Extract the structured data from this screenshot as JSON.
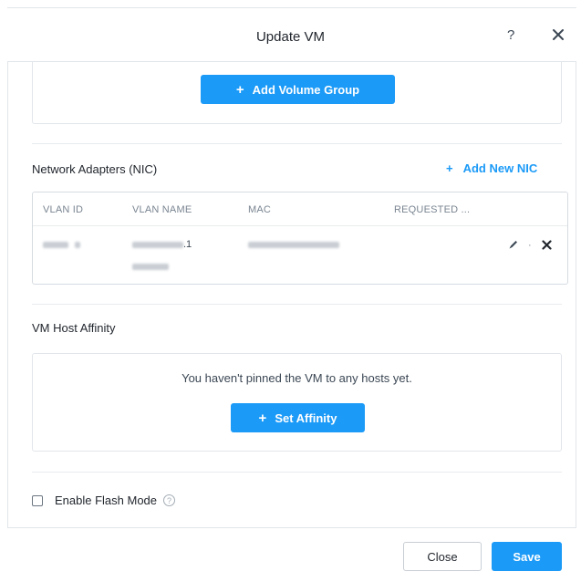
{
  "dialog": {
    "title": "Update VM",
    "help_label": "?",
    "close_icon": "close-icon"
  },
  "volume_groups": {
    "add_button_label": "Add Volume Group",
    "add_button_icon": "+"
  },
  "network_adapters": {
    "section_title": "Network Adapters (NIC)",
    "add_nic_label": "Add New NIC",
    "add_nic_icon": "+",
    "columns": [
      "VLAN ID",
      "VLAN NAME",
      "MAC",
      "REQUESTED ..."
    ],
    "rows": [
      {
        "vlan_id": "",
        "vlan_name_suffix": ".1",
        "mac": "",
        "requested": "",
        "actions": [
          "pencil-icon",
          "close-icon"
        ],
        "action_separator": "·"
      }
    ]
  },
  "vm_host_affinity": {
    "section_title": "VM Host Affinity",
    "empty_message": "You haven't pinned the VM to any hosts yet.",
    "set_affinity_label": "Set Affinity",
    "set_affinity_icon": "+"
  },
  "flash_mode": {
    "label": "Enable Flash Mode",
    "checked": false,
    "help_icon": "?"
  },
  "footer": {
    "close_label": "Close",
    "save_label": "Save"
  },
  "colors": {
    "primary": "#1b9af7",
    "text": "#22272e",
    "muted": "#7a8591",
    "border": "#e2e6ea"
  }
}
